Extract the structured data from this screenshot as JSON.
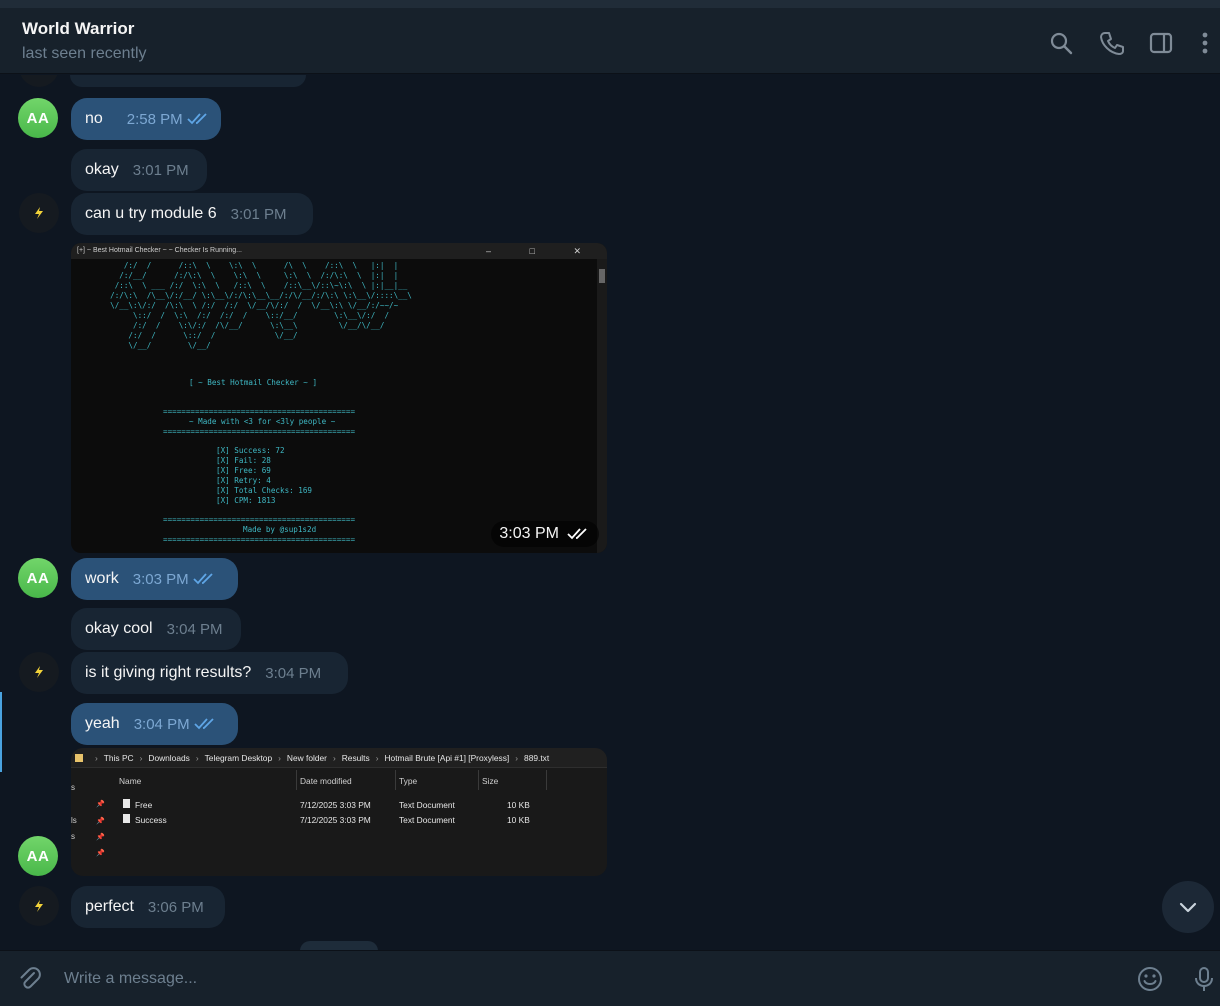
{
  "header": {
    "title": "World Warrior",
    "status": "last seen recently"
  },
  "avatars": {
    "initials": "AA"
  },
  "messages": [
    {
      "text": "no",
      "time": "2:58 PM",
      "dir": "out"
    },
    {
      "text": "okay",
      "time": "3:01 PM",
      "dir": "in"
    },
    {
      "text": "can u try module 6",
      "time": "3:01 PM",
      "dir": "in"
    },
    {
      "text": "work",
      "time": "3:03 PM",
      "dir": "out"
    },
    {
      "text": "okay cool",
      "time": "3:04 PM",
      "dir": "in"
    },
    {
      "text": "is it giving right results?",
      "time": "3:04 PM",
      "dir": "in"
    },
    {
      "text": "yeah",
      "time": "3:04 PM",
      "dir": "out"
    },
    {
      "text": "perfect",
      "time": "3:06 PM",
      "dir": "in"
    }
  ],
  "console_photo": {
    "time": "3:03 PM",
    "window_title": "[+] ~ Best Hotmail Checker ~ ~ Checker Is Running...",
    "ascii_art": "     /:/  /      /::\\  \\    \\:\\  \\      /\\  \\    /::\\  \\   |:|  |\n    /:/__/      /:/\\:\\  \\    \\:\\  \\     \\:\\  \\  /:/\\:\\  \\  |:|  |\n   /::\\  \\ ___ /:/  \\:\\  \\   /::\\  \\    /::\\__\\/::\\~\\:\\  \\ |:|__|__\n  /:/\\:\\  /\\__\\/:/__/ \\:\\__\\/:/\\:\\__\\__/:/\\/__/:/\\:\\ \\:\\__\\/::::\\__\\\n  \\/__\\:\\/:/  /\\:\\  \\ /:/  /:/  \\/__/\\/:/  /  \\/__\\:\\ \\/__/:/~~/~\n       \\::/  /  \\:\\  /:/  /:/  /    \\::/__/        \\:\\__\\/:/  /\n       /:/  /    \\:\\/:/  /\\/__/      \\:\\__\\         \\/__/\\/__/\n      /:/  /      \\::/  /             \\/__/\n      \\/__/        \\/__/",
    "banner_title": "[ ~ Best Hotmail Checker ~ ]",
    "separator": "==========================================",
    "made_with": "~ Made with <3 for <3ly people ~",
    "stats": [
      "[X] Success: 72",
      "[X] Fail: 28",
      "[X] Free: 69",
      "[X] Retry: 4",
      "[X] Total Checks: 169",
      "[X] CPM: 1813"
    ],
    "made_by": "Made by @sup1s2d"
  },
  "explorer_photo": {
    "path": [
      "This PC",
      "Downloads",
      "Telegram Desktop",
      "New folder",
      "Results",
      "Hotmail Brute [Api #1] [Proxyless]",
      "889.txt"
    ],
    "columns": [
      "Name",
      "Date modified",
      "Type",
      "Size"
    ],
    "rows": [
      {
        "name": "Free",
        "date": "7/12/2025 3:03 PM",
        "type": "Text Document",
        "size": "10 KB"
      },
      {
        "name": "Success",
        "date": "7/12/2025 3:03 PM",
        "type": "Text Document",
        "size": "10 KB"
      }
    ],
    "sidebar_fragments": [
      "s",
      "ls",
      "s"
    ]
  },
  "composer": {
    "placeholder": "Write a message..."
  },
  "icons": {
    "header": [
      "search-icon",
      "phone-icon",
      "sidebar-toggle-icon",
      "more-vertical-icon"
    ],
    "composer": [
      "paperclip-icon",
      "emoji-icon",
      "microphone-icon"
    ],
    "scroll": "chevron-down-icon"
  },
  "colors": {
    "background": "#0e1621",
    "header": "#17212b",
    "incoming_bubble": "#182533",
    "outgoing_bubble": "#2b5278",
    "avatar_green": "#55c150",
    "console_text": "#3fb8c4"
  }
}
